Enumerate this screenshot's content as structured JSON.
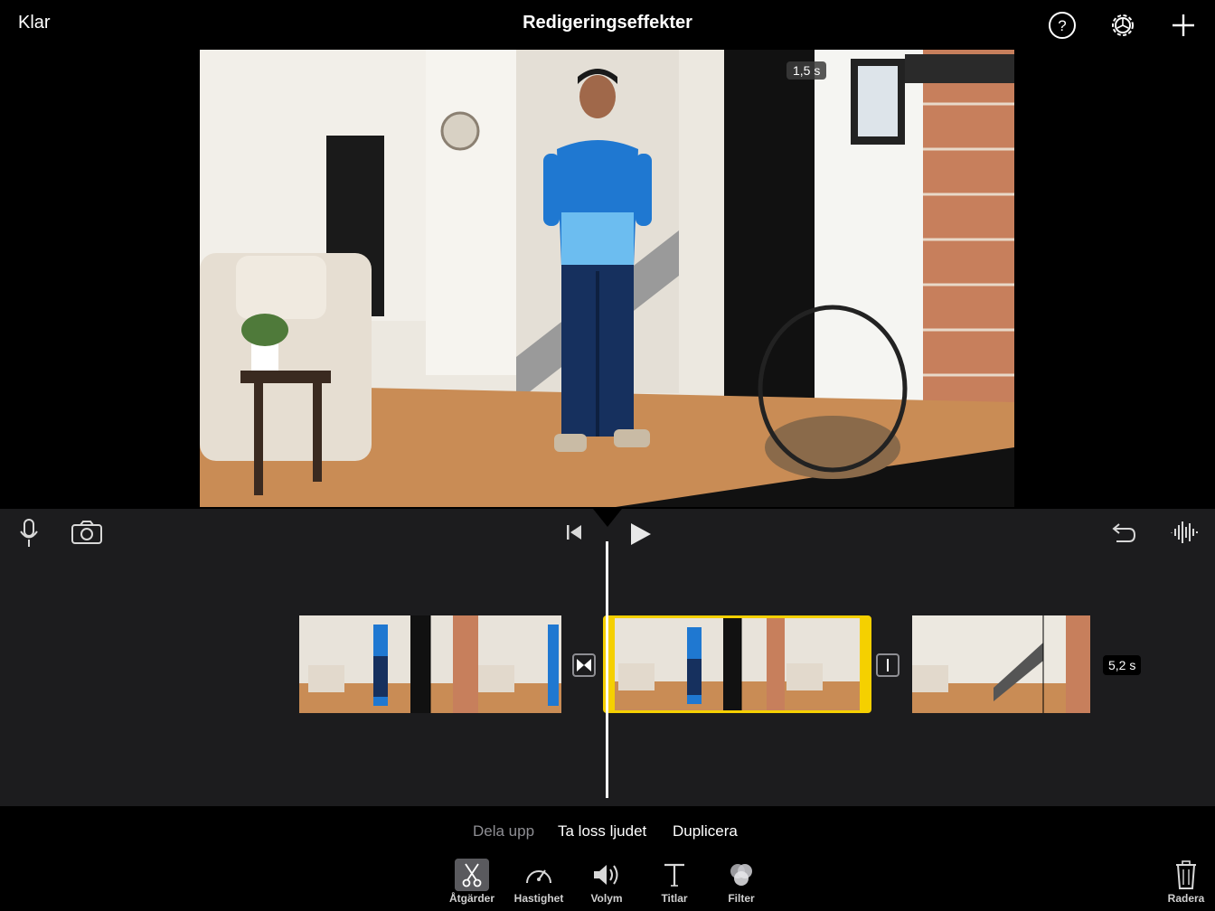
{
  "header": {
    "done_label": "Klar",
    "title": "Redigeringseffekter",
    "help_icon": "help-icon",
    "settings_icon": "gear-icon",
    "add_icon": "plus-icon"
  },
  "viewer": {
    "clip_time": "1,5 s",
    "zoom_icon": "zoom-in-icon"
  },
  "timeline": {
    "selected_clip_duration": "5,2 s",
    "selected_clip_color": "#f5d000"
  },
  "actions": {
    "split": "Dela upp",
    "detach_audio": "Ta loss ljudet",
    "duplicate": "Duplicera"
  },
  "tools": [
    {
      "label": "Åtgärder",
      "icon": "scissors-icon",
      "active": true
    },
    {
      "label": "Hastighet",
      "icon": "speedometer-icon"
    },
    {
      "label": "Volym",
      "icon": "speaker-icon"
    },
    {
      "label": "Titlar",
      "icon": "text-icon"
    },
    {
      "label": "Filter",
      "icon": "filter-icon"
    }
  ],
  "delete_label": "Radera"
}
